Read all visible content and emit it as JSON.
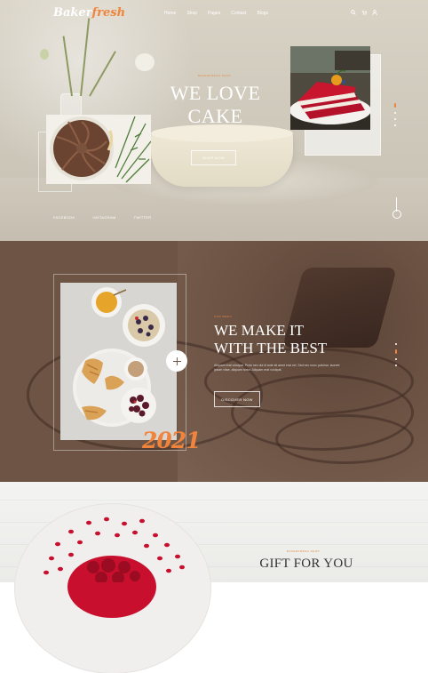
{
  "brand": {
    "logo_main": "Baker",
    "logo_accent": "fresh",
    "accent_color": "#f0843c"
  },
  "nav": {
    "items": [
      "Home",
      "Shop",
      "Pages",
      "Contact",
      "Blogs"
    ]
  },
  "header_icons": [
    "search-icon",
    "cart-icon",
    "user-icon"
  ],
  "hero": {
    "eyebrow": "BAKERFRESH SHOP",
    "title_line1": "WE LOVE",
    "title_line2": "CAKE",
    "cta": "SHOP NOW",
    "social": [
      "FACEBOOK",
      "INSTAGRAM",
      "TWITTER"
    ],
    "slide_index": 1,
    "slide_count": 4
  },
  "about": {
    "eyebrow": "OUR MENU",
    "title_line1": "WE MAKE IT",
    "title_line2": "WITH THE BEST",
    "text": "Aliquam erat volutpat. Proin nec dui id ante sit amet erat vel. Sed nec nunc pulvinar, laoreet ipsum vitae, aliquam tortor. Aliquam erat volutpat.",
    "cta": "DISCOVER NOW",
    "year": "2021",
    "slide_index": 1,
    "slide_count": 4
  },
  "gift": {
    "eyebrow": "BAKERFRESH SHOP",
    "title": "GIFT FOR YOU"
  }
}
